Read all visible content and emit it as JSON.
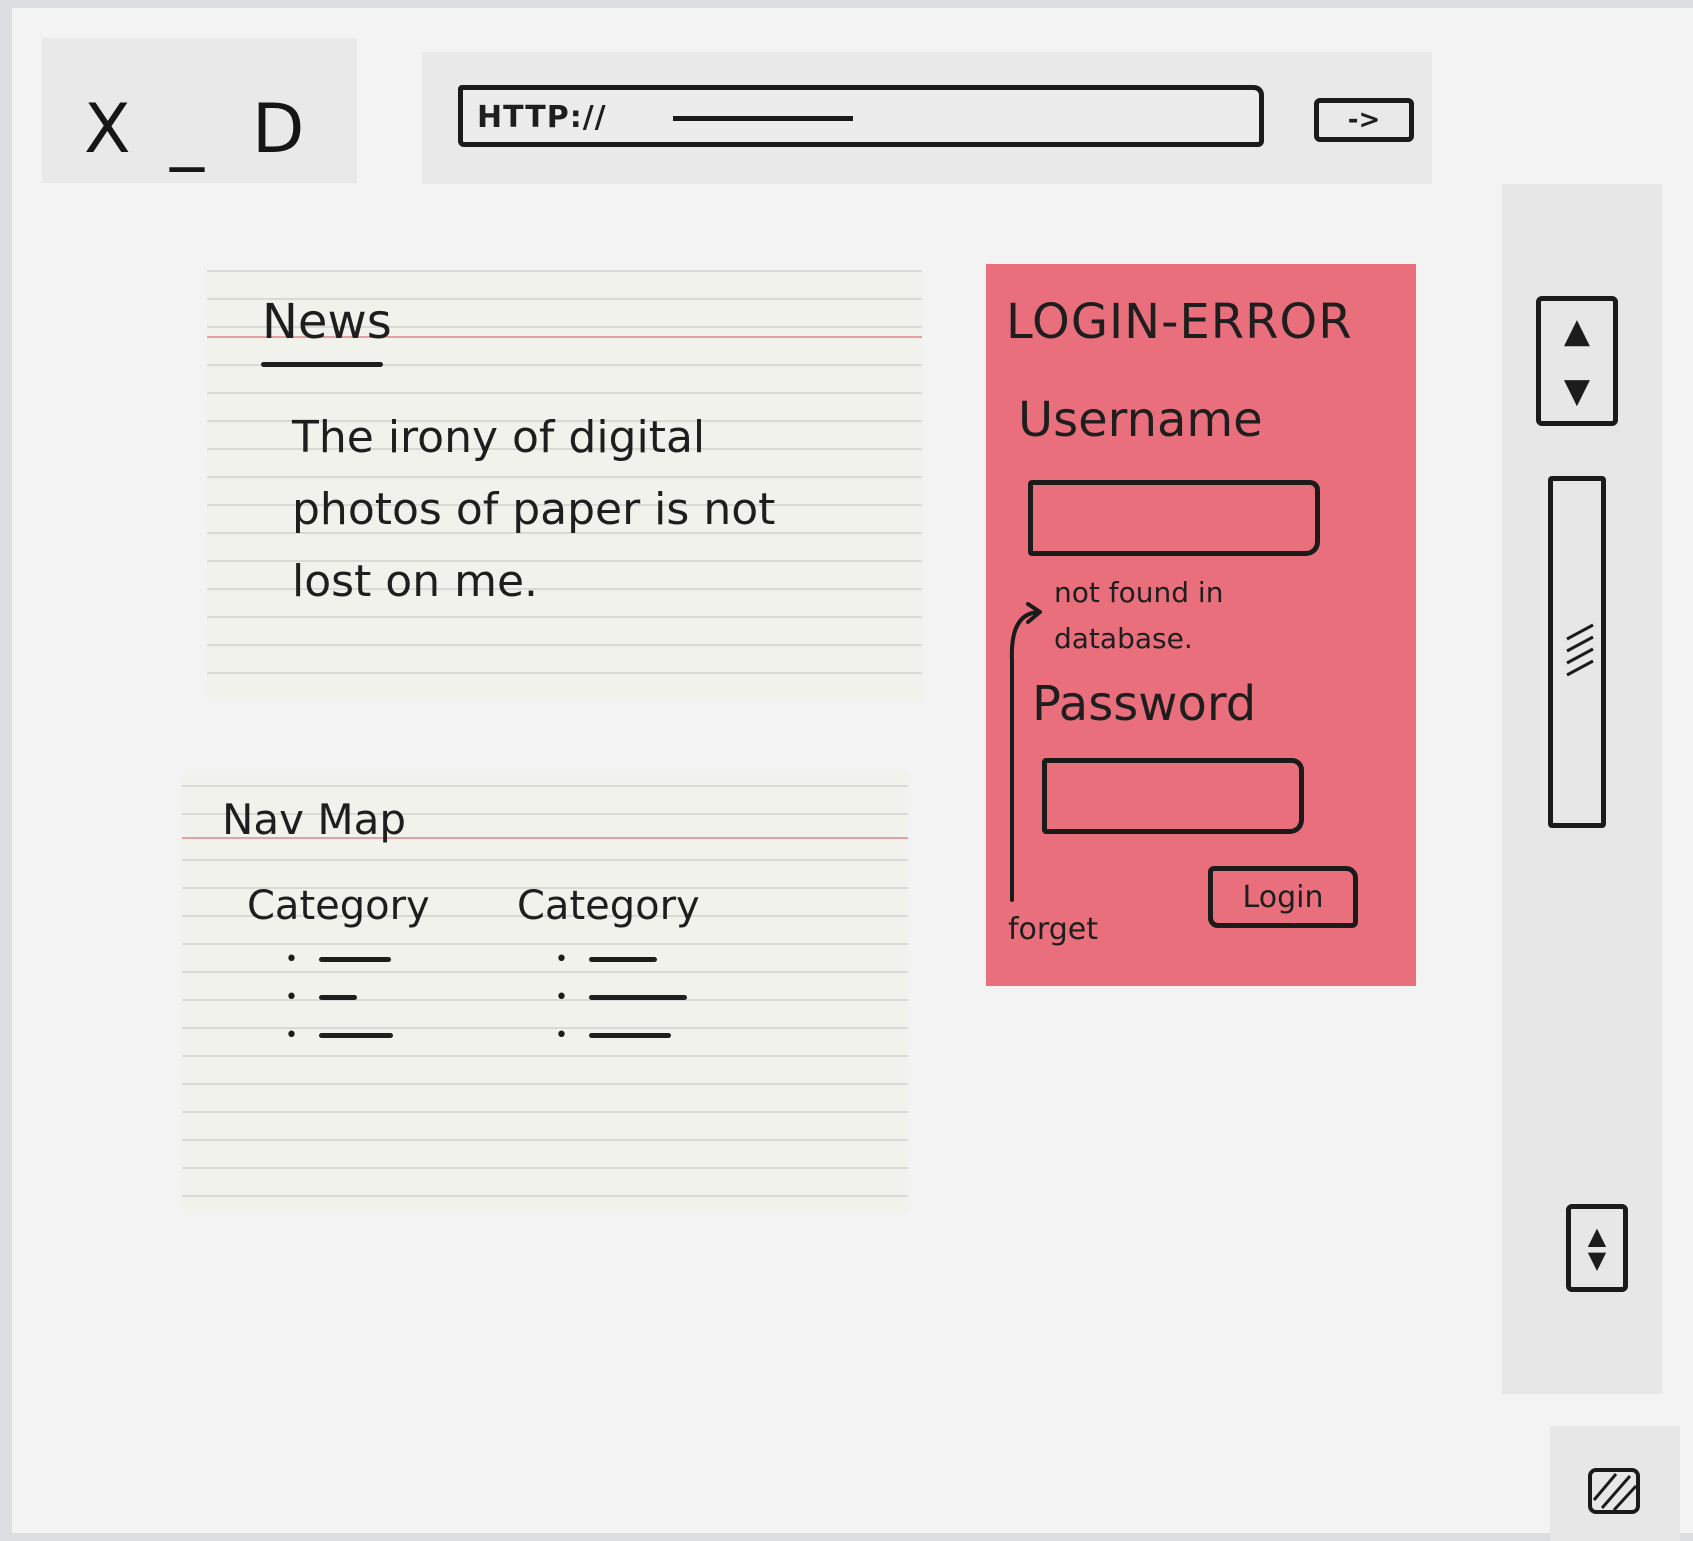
{
  "window_controls": {
    "close": "X",
    "minimize": "_",
    "maximize": "D"
  },
  "address_bar": {
    "text": "HTTP://",
    "go_label": "->"
  },
  "news": {
    "title": "News",
    "body": "The irony of digital photos of paper is not lost on me."
  },
  "nav_map": {
    "title": "Nav Map",
    "columns": [
      {
        "label": "Category"
      },
      {
        "label": "Category"
      }
    ]
  },
  "login": {
    "title": "LOGIN-ERROR",
    "username_label": "Username",
    "error_message": "not found in database.",
    "password_label": "Password",
    "login_button": "Login",
    "forget_link": "forget"
  },
  "colors": {
    "sticky_note": "#ea6f7d",
    "index_card": "#f2f2ec",
    "ink": "#1e1e1e"
  },
  "icons": [
    "scroll-up-icon",
    "scroll-down-icon",
    "resize-grip-icon",
    "go-arrow-icon"
  ]
}
